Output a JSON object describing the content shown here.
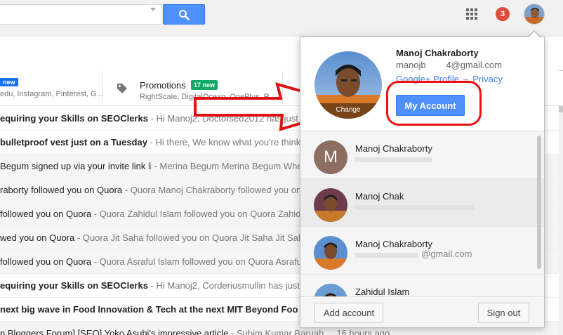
{
  "header": {
    "search": {
      "value": ""
    },
    "notification_count": "3"
  },
  "tabs": {
    "primary": {
      "badge": "new",
      "snippet": "edu, Instagram, Pinterest, G..."
    },
    "promotions": {
      "title": "Promotions",
      "badge": "17 new",
      "snippet": "RightScale, DigitalOcean, OnePlus, R..."
    }
  },
  "emails": [
    {
      "subject": "equiring your Skills on SEOClerks",
      "snippet": " - Hi Manoj2, Doctorseo2012 has just ...",
      "unread": true
    },
    {
      "subject": "bulletproof vest just on a Tuesday",
      "snippet": " - Hi there, We know what you're think...",
      "unread": true
    },
    {
      "subject": "Begum signed up via your invite link",
      "snippet": " ℹ - Merina Begum Merina Begum Whe...",
      "unread": false
    },
    {
      "subject": "raborty followed you on Quora",
      "snippet": " - Quora Manoj Chakraborty followed you on Quora...",
      "unread": false
    },
    {
      "subject": "followed you on Quora",
      "snippet": " - Quora Zahidul Islam followed you on Quora Zahid...",
      "unread": false
    },
    {
      "subject": "wed you on Quora",
      "snippet": " - Quora Jit Saha followed you on Quora Jit Saha Jit Saha followed...",
      "unread": false
    },
    {
      "subject": "followed you on Quora",
      "snippet": " - Quora Asraful Islam followed you on Quora Asraful...",
      "unread": false
    },
    {
      "subject": "equiring your Skills on SEOClerks",
      "snippet": " - Hi Manoj2, Corderiusmullin has just ...",
      "unread": true
    },
    {
      "subject": "next big wave in Food Innovation & Tech at the next MIT Beyond Foo",
      "snippet": "",
      "unread": true
    },
    {
      "subject": "n Bloggers Forum] [SEO] Yoko Asubi's impressive article",
      "snippet": " - Subim Kumar Baruah ... 16 hours ago ...",
      "unread": false
    }
  ],
  "account_popup": {
    "name": "Manoj Chakraborty",
    "email": "manojb           4@gmail.com",
    "change_label": "Change",
    "links": {
      "google_plus": "Google+ Profile",
      "separator": "–",
      "privacy": "Privacy"
    },
    "my_account_label": "My Account",
    "accounts": [
      {
        "name": "Manoj Chakraborty",
        "letter": "M"
      },
      {
        "name": "Manoj Chak"
      },
      {
        "name": "Manoj Chakraborty",
        "email_fragment": "@gmail.com"
      },
      {
        "name": "Zahidul Islam"
      }
    ],
    "add_account_label": "Add account",
    "sign_out_label": "Sign out"
  },
  "colors": {
    "accent_blue": "#4d90fe",
    "annotation_red": "#e11111",
    "promo_green": "#16a765",
    "notif_red": "#dd4b39"
  }
}
